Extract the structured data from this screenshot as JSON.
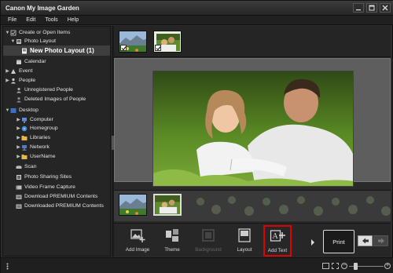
{
  "window": {
    "title": "Canon My Image Garden"
  },
  "menubar": {
    "items": [
      "File",
      "Edit",
      "Tools",
      "Help"
    ]
  },
  "sidebar": {
    "items": [
      {
        "label": "Create or Open Items",
        "icon": "create-items-icon",
        "arrow": "▼"
      },
      {
        "label": "Photo Layout",
        "icon": "photo-layout-icon",
        "arrow": "▼"
      },
      {
        "label": "New Photo Layout (1)",
        "icon": "layout-item-icon",
        "arrow": ""
      },
      {
        "label": "Calendar",
        "icon": "calendar-icon",
        "arrow": ""
      },
      {
        "label": "Event",
        "icon": "event-icon",
        "arrow": "▶"
      },
      {
        "label": "People",
        "icon": "people-icon",
        "arrow": "▶"
      },
      {
        "label": "Unregistered People",
        "icon": "unregistered-people-icon",
        "arrow": ""
      },
      {
        "label": "Deleted Images of People",
        "icon": "deleted-people-icon",
        "arrow": ""
      },
      {
        "label": "Desktop",
        "icon": "desktop-icon",
        "arrow": "▼"
      },
      {
        "label": "Computer",
        "icon": "computer-icon",
        "arrow": "▶"
      },
      {
        "label": "Homegroup",
        "icon": "homegroup-icon",
        "arrow": "▶"
      },
      {
        "label": "Libraries",
        "icon": "libraries-icon",
        "arrow": "▶"
      },
      {
        "label": "Network",
        "icon": "network-icon",
        "arrow": "▶"
      },
      {
        "label": "UserName",
        "icon": "user-folder-icon",
        "arrow": "▶"
      },
      {
        "label": "Scan",
        "icon": "scan-icon",
        "arrow": ""
      },
      {
        "label": "Photo Sharing Sites",
        "icon": "photo-sharing-icon",
        "arrow": ""
      },
      {
        "label": "Video Frame Capture",
        "icon": "video-capture-icon",
        "arrow": ""
      },
      {
        "label": "Download PREMIUM Contents",
        "icon": "download-premium-icon",
        "arrow": ""
      },
      {
        "label": "Downloaded PREMIUM Contents",
        "icon": "downloaded-premium-icon",
        "arrow": ""
      }
    ]
  },
  "toolbar": {
    "add_image": "Add Image",
    "theme": "Theme",
    "background": "Background",
    "layout": "Layout",
    "add_text": "Add Text",
    "print": "Print"
  },
  "colors": {
    "highlight": "#e00000",
    "background": "#2b2b2b",
    "preview": "#5e5e5e"
  }
}
